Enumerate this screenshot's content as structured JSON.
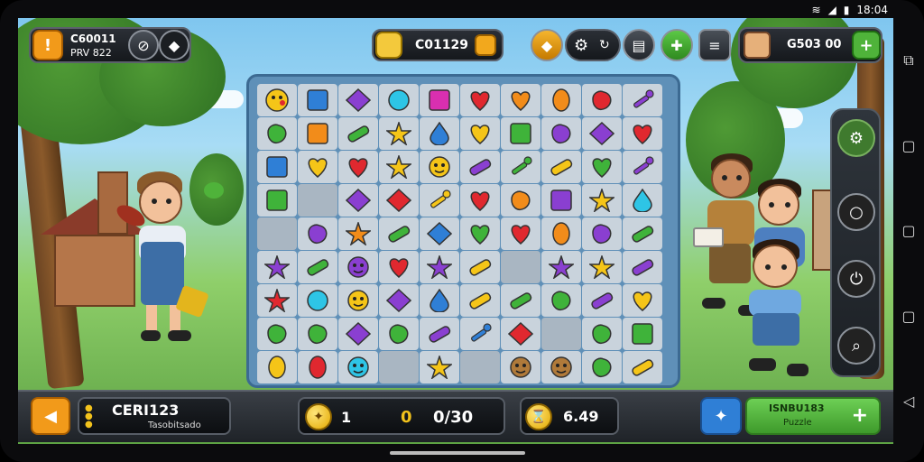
{
  "status": {
    "time": "18:04"
  },
  "top_left": {
    "line1": "C60011",
    "line2": "PRV 822"
  },
  "top_center": {
    "score": "C01129"
  },
  "top_right": {
    "coins": "G503 00"
  },
  "bottom": {
    "player_name": "CERI123",
    "player_sub": "Tasobitsado",
    "left_count": "1",
    "progress": "0/30",
    "progress_prefix": "0",
    "timer": "6.49",
    "mode_title": "ISNBU183",
    "mode_sub": "Puzzle"
  },
  "colors": {
    "accent_orange": "#f29a1a",
    "accent_green": "#4fb33a",
    "accent_blue": "#2f7fd6",
    "board_frame": "#3c6a92"
  },
  "board": {
    "rows": [
      [
        "smiley-yellow",
        "square-blue",
        "diamond-purple",
        "orb-cyan",
        "square-magenta",
        "heart-red",
        "heart-orange",
        "egg-orange",
        "blob-red",
        "wand-purple"
      ],
      [
        "blob-green",
        "square-orange",
        "bar-green",
        "star-yellow",
        "drop-blue",
        "heart-yellow",
        "square-green",
        "blob-purple",
        "diamond-purple",
        "heart-red"
      ],
      [
        "square-blue",
        "heart-yellow",
        "heart-red",
        "star-yellow",
        "face-yellow",
        "bar-purple",
        "wand-green",
        "bar-yellow",
        "heart-green",
        "wand-purple"
      ],
      [
        "square-green",
        "empty",
        "diamond-purple",
        "diamond-red",
        "wand-yellow",
        "heart-red",
        "blob-orange",
        "square-purple",
        "star-yellow",
        "drop-cyan"
      ],
      [
        "empty",
        "blob-purple",
        "star-orange",
        "bar-green",
        "diamond-blue",
        "heart-green",
        "heart-red",
        "egg-orange",
        "blob-purple",
        "bar-green"
      ],
      [
        "star-purple",
        "bar-green",
        "face-purple",
        "heart-red",
        "star-purple",
        "bar-yellow",
        "empty",
        "star-purple",
        "star-yellow",
        "bar-purple"
      ],
      [
        "star-red",
        "orb-cyan",
        "face-yellow",
        "diamond-purple",
        "drop-blue",
        "bar-yellow",
        "bar-green",
        "blob-green",
        "bar-purple",
        "heart-yellow"
      ],
      [
        "blob-green",
        "blob-green",
        "diamond-purple",
        "blob-green",
        "bar-purple",
        "wand-blue",
        "diamond-red",
        "empty",
        "blob-green",
        "square-green"
      ],
      [
        "egg-yellow",
        "egg-red",
        "face-cyan",
        "empty",
        "star-yellow",
        "empty",
        "face-brown",
        "face-brown",
        "blob-green",
        "bar-yellow"
      ]
    ]
  }
}
